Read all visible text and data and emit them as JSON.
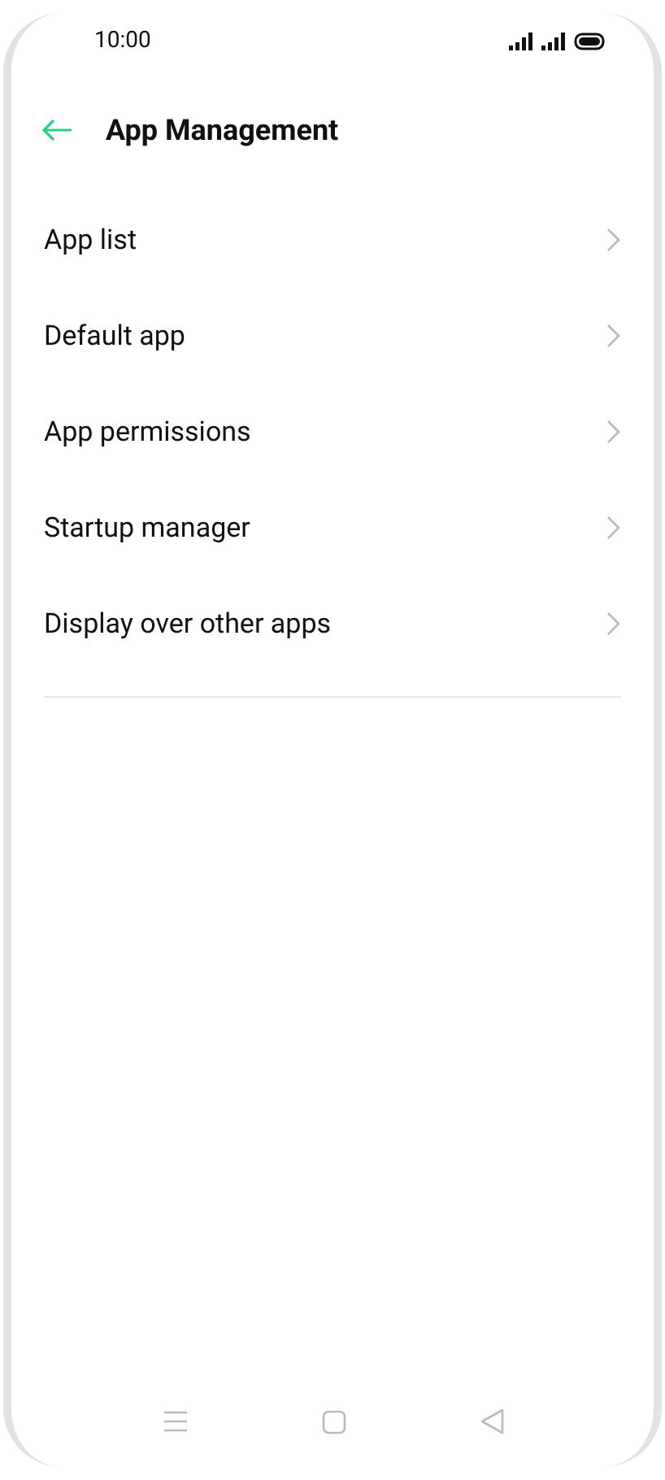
{
  "status_bar": {
    "time": "10:00"
  },
  "header": {
    "title": "App Management"
  },
  "items": [
    {
      "label": "App list"
    },
    {
      "label": "Default app"
    },
    {
      "label": "App permissions"
    },
    {
      "label": "Startup manager"
    },
    {
      "label": "Display over other apps"
    }
  ]
}
